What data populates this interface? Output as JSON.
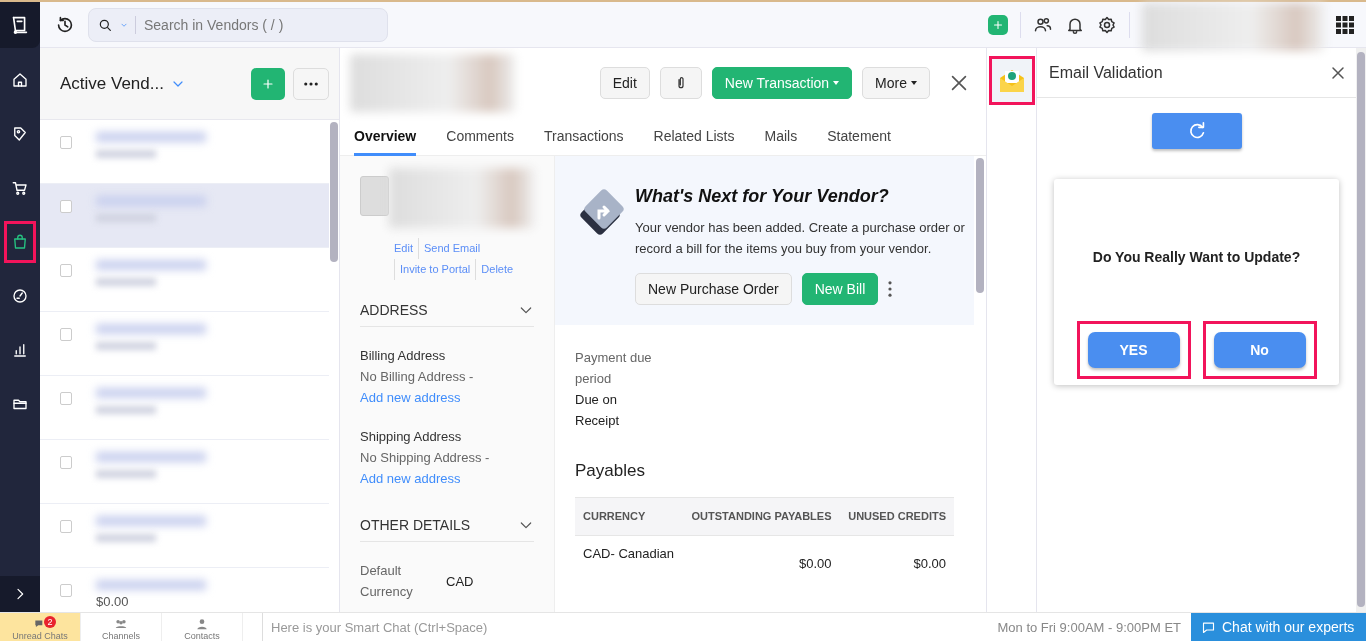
{
  "top_bar": {
    "search_placeholder": "Search in Vendors ( / )"
  },
  "nav": {
    "items": [
      {
        "selected": false,
        "highlighted": false
      },
      {
        "selected": false,
        "highlighted": false
      },
      {
        "selected": false,
        "highlighted": false
      },
      {
        "selected": true,
        "highlighted": true
      },
      {
        "selected": false,
        "highlighted": false
      },
      {
        "selected": false,
        "highlighted": false
      },
      {
        "selected": false,
        "highlighted": false
      }
    ]
  },
  "vendor_list": {
    "title": "Active Vend...",
    "rows": [
      {
        "selected": false
      },
      {
        "selected": true
      },
      {
        "selected": false
      },
      {
        "selected": false
      },
      {
        "selected": false
      },
      {
        "selected": false
      },
      {
        "selected": false
      },
      {
        "selected": false,
        "amount": "$0.00"
      }
    ]
  },
  "detail": {
    "actions": [
      {
        "kind": "button",
        "label": "Edit"
      },
      {
        "kind": "attach"
      },
      {
        "kind": "primary",
        "label": "New Transaction"
      },
      {
        "kind": "menu",
        "label": "More"
      }
    ],
    "tabs": [
      {
        "label": "Overview",
        "selected": true
      },
      {
        "label": "Comments",
        "selected": false
      },
      {
        "label": "Transactions",
        "selected": false
      },
      {
        "label": "Related Lists",
        "selected": false
      },
      {
        "label": "Mails",
        "selected": false
      },
      {
        "label": "Statement",
        "selected": false
      }
    ],
    "contact_links": [
      "Edit",
      "Send Email",
      "Invite to Portal",
      "Delete"
    ],
    "address": {
      "heading": "ADDRESS",
      "blocks": [
        {
          "label": "Billing Address",
          "value": "No Billing Address - ",
          "link": "Add new address"
        },
        {
          "label": "Shipping Address",
          "value": "No Shipping Address - ",
          "link": "Add new address"
        }
      ]
    },
    "other_details": {
      "heading": "OTHER DETAILS",
      "fields": [
        {
          "label": "Default Currency",
          "value": "CAD"
        }
      ]
    },
    "whats_next": {
      "title": "What's Next for Your Vendor?",
      "text": "Your vendor has been added. Create a purchase order or record a bill for the items you buy from your vendor.",
      "buttons": [
        {
          "kind": "secondary",
          "label": "New Purchase Order"
        },
        {
          "kind": "primary",
          "label": "New Bill"
        }
      ]
    },
    "payment": {
      "label": "Payment due period",
      "value": "Due on Receipt"
    },
    "payables": {
      "title": "Payables",
      "columns": [
        "CURRENCY",
        "OUTSTANDING PAYABLES",
        "UNUSED CREDITS"
      ],
      "rows": [
        [
          "CAD- Canadian",
          "$0.00",
          "$0.00"
        ]
      ]
    }
  },
  "email_panel": {
    "title": "Email Validation",
    "icon_highlighted": true,
    "dialog": {
      "question": "Do You Really Want to Update?",
      "buttons": [
        {
          "label": "YES",
          "highlighted": true
        },
        {
          "label": "No",
          "highlighted": true
        }
      ]
    }
  },
  "bottom_bar": {
    "tabs": [
      {
        "label": "Unread Chats",
        "badge": "2",
        "selected": true
      },
      {
        "label": "Channels",
        "selected": false
      },
      {
        "label": "Contacts",
        "selected": false
      }
    ],
    "chat_placeholder": "Here is your Smart Chat (Ctrl+Space)",
    "hours": "Mon to Fri 9:00AM - 9:00PM ET",
    "chat_button": "Chat with our experts"
  }
}
